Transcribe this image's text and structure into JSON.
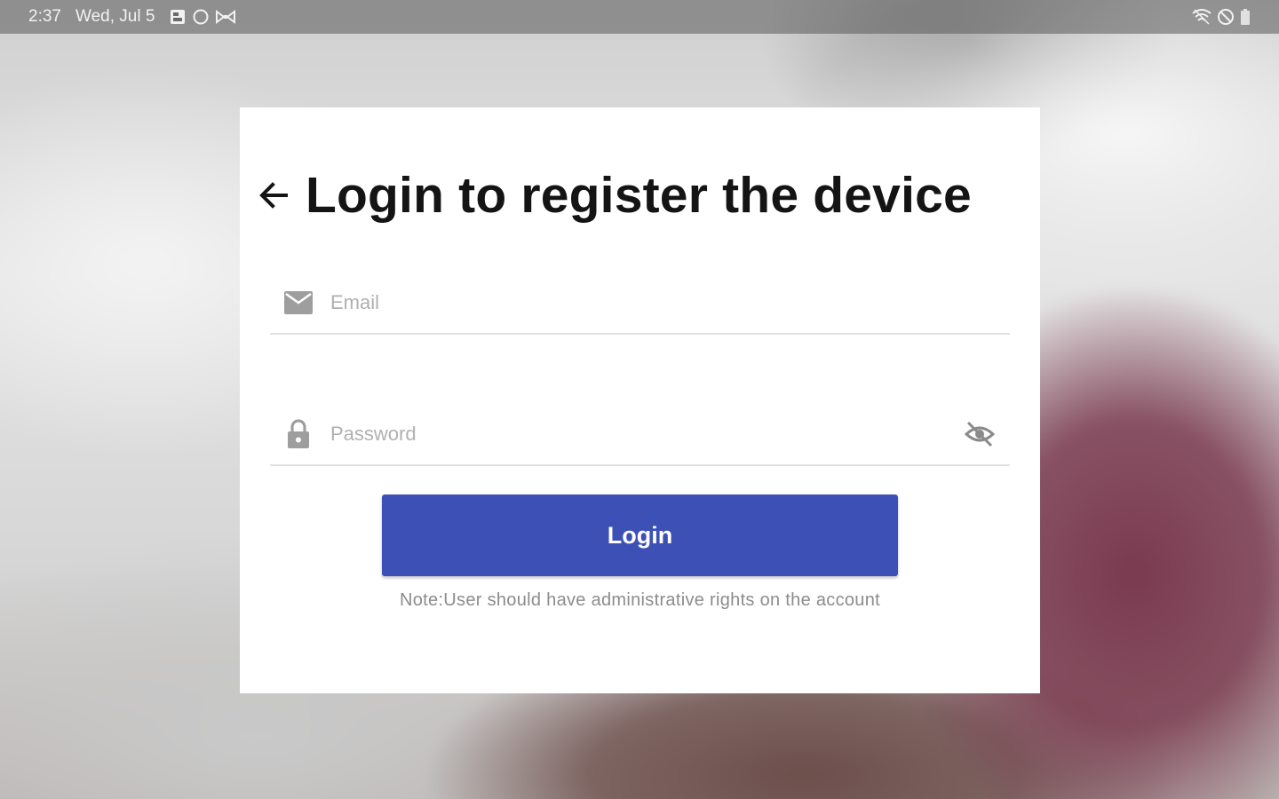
{
  "status_bar": {
    "time": "2:37",
    "date": "Wed, Jul 5",
    "left_icons": [
      "gallery-icon",
      "circle-icon",
      "bowtie-icon"
    ],
    "right_icons": [
      "wifi-icon",
      "do-not-disturb-icon",
      "battery-icon"
    ]
  },
  "login_card": {
    "title": "Login to register the device",
    "email": {
      "placeholder": "Email",
      "value": ""
    },
    "password": {
      "placeholder": "Password",
      "value": ""
    },
    "login_label": "Login",
    "note": "Note:User should have administrative rights on the account"
  },
  "colors": {
    "primary": "#3d50b6",
    "card_background": "#ffffff",
    "icon_gray": "#9e9e9e"
  }
}
